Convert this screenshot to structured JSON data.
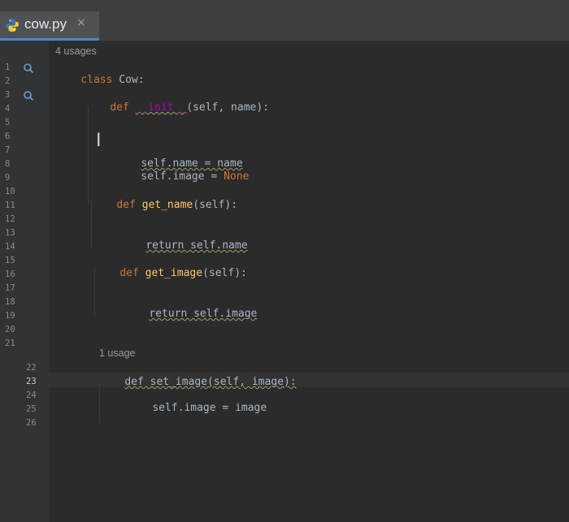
{
  "tab": {
    "filename": "cow.py",
    "close_glyph": "×",
    "icon": "python-icon"
  },
  "gutter": {
    "line_numbers": [
      "1",
      "2",
      "3",
      "4",
      "5",
      "6",
      "7",
      "8",
      "9",
      "10",
      "11",
      "12",
      "13",
      "14",
      "15",
      "16",
      "17",
      "18",
      "19",
      "20",
      "21",
      "22",
      "23",
      "24",
      "25",
      "26"
    ],
    "current_line": "23"
  },
  "code": {
    "usages_class": "4 usages",
    "l1_kw": "class",
    "l1_name": "Cow:",
    "l3_def": "def",
    "l3_init": "__init__",
    "l3_params": "(self, name):",
    "l7": "self.name = name",
    "l8_self": "self.image",
    "l8_eq": " = ",
    "l8_none": "None",
    "l10_def": "def",
    "l10_name": "get_name",
    "l10_params": "(self):",
    "l13": "return self.name",
    "l15_def": "def",
    "l15_name": "get_image",
    "l15_params": "(self):",
    "l18": "return self.image",
    "usages_set": "1 usage",
    "l22": "def set_image(self, image):",
    "l24_self": "self.image",
    "l24_eq": " = ",
    "l24_val": "image"
  },
  "colors": {
    "keyword": "#cc7832",
    "function": "#ffc66d",
    "dunder": "#b200b2",
    "text": "#a9b7c6",
    "background": "#2b2b2b",
    "tab_accent": "#4a88c7"
  }
}
